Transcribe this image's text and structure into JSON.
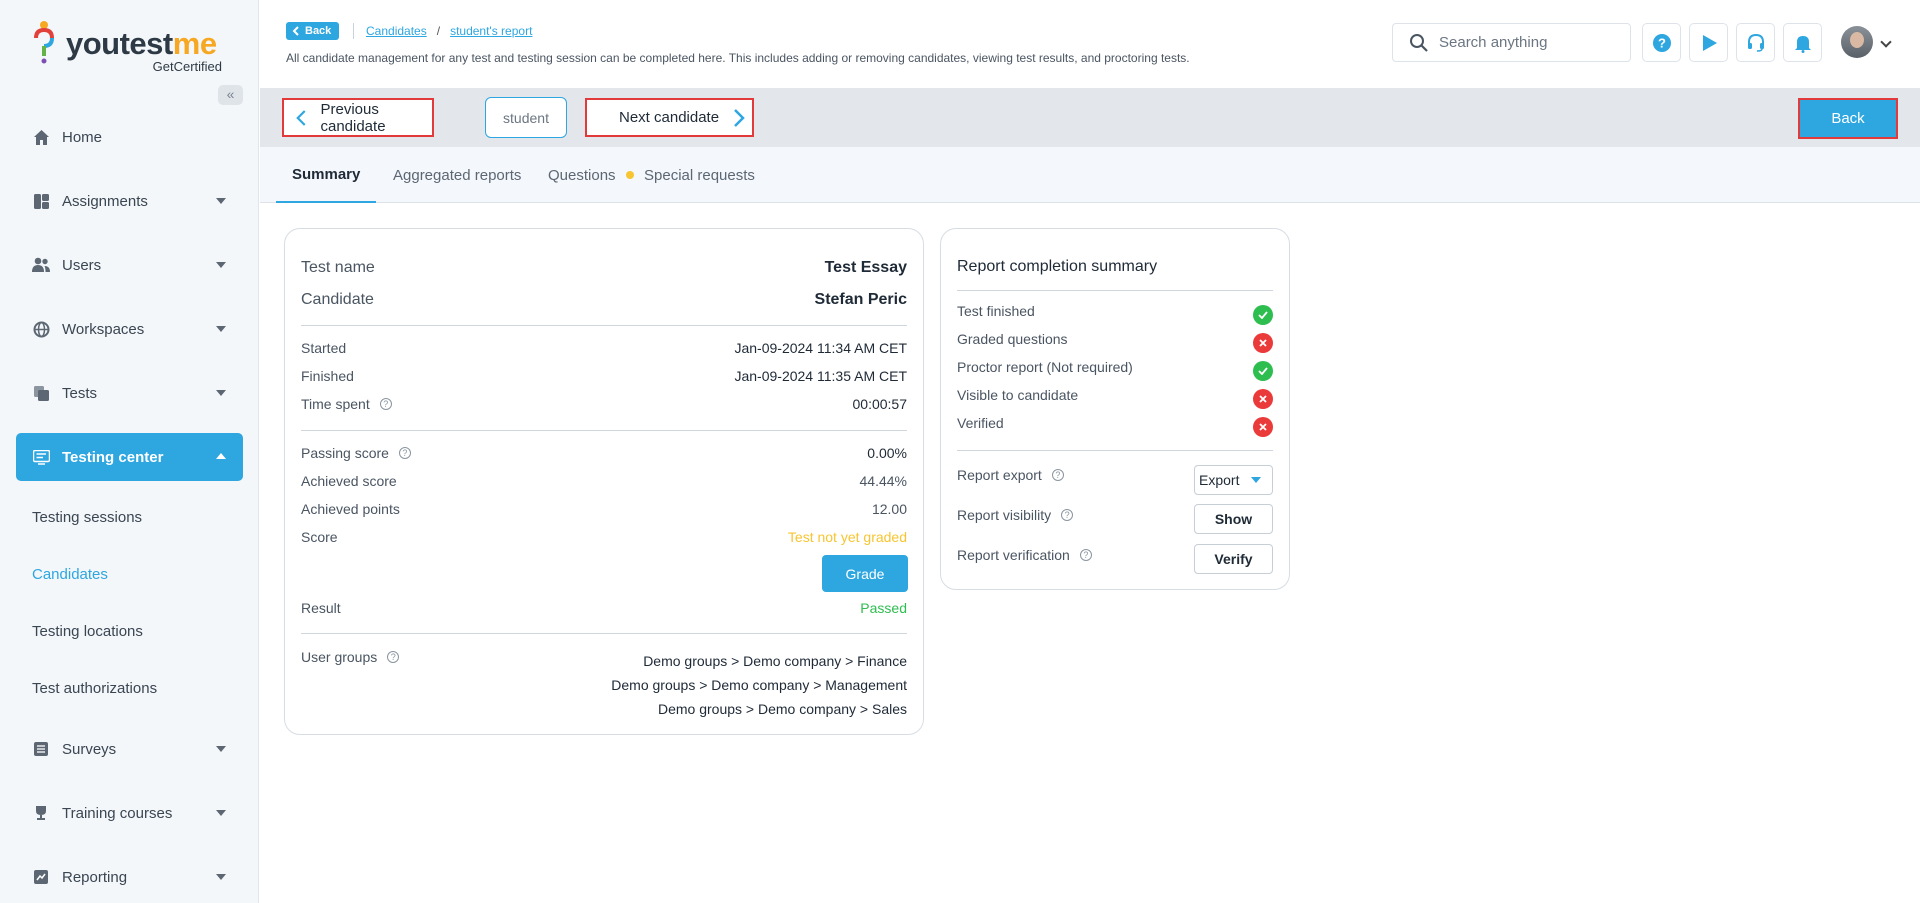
{
  "brand": {
    "name_part1": "youtest",
    "name_part2": "me",
    "sub": "GetCertified"
  },
  "sidebar": {
    "collapse_glyph": "«",
    "items": [
      {
        "label": "Home",
        "icon": "home-icon"
      },
      {
        "label": "Assignments",
        "icon": "assignments-icon"
      },
      {
        "label": "Users",
        "icon": "users-icon"
      },
      {
        "label": "Workspaces",
        "icon": "globe-icon"
      },
      {
        "label": "Tests",
        "icon": "tests-icon"
      },
      {
        "label": "Testing center",
        "icon": "testing-center-icon"
      }
    ],
    "sub_items": [
      "Testing sessions",
      "Candidates",
      "Testing locations",
      "Test authorizations"
    ],
    "items_after": [
      {
        "label": "Surveys",
        "icon": "surveys-icon"
      },
      {
        "label": "Training courses",
        "icon": "trophy-icon"
      },
      {
        "label": "Reporting",
        "icon": "reporting-icon"
      }
    ]
  },
  "header": {
    "back_label": "Back",
    "breadcrumb": [
      "Candidates",
      "student's report"
    ],
    "separator": "/",
    "description": "All candidate management for any test and testing session can be completed here. This includes adding or removing candidates, viewing test results, and proctoring tests.",
    "search_placeholder": "Search anything"
  },
  "candidate_nav": {
    "prev_label": "Previous candidate",
    "current": "student",
    "next_label": "Next candidate",
    "back_label": "Back"
  },
  "tabs": [
    "Summary",
    "Aggregated reports",
    "Questions",
    "Special requests"
  ],
  "summary": {
    "test_name_label": "Test name",
    "test_name": "Test Essay",
    "candidate_label": "Candidate",
    "candidate": "Stefan Peric",
    "started_label": "Started",
    "started": "Jan-09-2024 11:34 AM CET",
    "finished_label": "Finished",
    "finished": "Jan-09-2024 11:35 AM CET",
    "time_spent_label": "Time spent",
    "time_spent": "00:00:57",
    "passing_score_label": "Passing score",
    "passing_score": "0.00%",
    "achieved_score_label": "Achieved score",
    "achieved_score": "44.44%",
    "achieved_points_label": "Achieved points",
    "achieved_points": "12.00",
    "score_label": "Score",
    "score": "Test not yet graded",
    "grade_button": "Grade",
    "result_label": "Result",
    "result": "Passed",
    "user_groups_label": "User groups",
    "user_groups": [
      "Demo groups > Demo company > Finance",
      "Demo groups > Demo company > Management",
      "Demo groups > Demo company > Sales"
    ]
  },
  "report": {
    "title": "Report completion summary",
    "checks": [
      {
        "label": "Test finished",
        "status": "ok"
      },
      {
        "label": "Graded questions",
        "status": "bad"
      },
      {
        "label": "Proctor report (Not required)",
        "status": "ok"
      },
      {
        "label": "Visible to candidate",
        "status": "bad"
      },
      {
        "label": "Verified",
        "status": "bad"
      }
    ],
    "export_label": "Report export",
    "export_button": "Export",
    "visibility_label": "Report visibility",
    "visibility_button": "Show",
    "verification_label": "Report verification",
    "verification_button": "Verify"
  },
  "colors": {
    "accent": "#2ea6e0",
    "warning": "#f7c531",
    "success": "#2ebd4f",
    "danger": "#ea3a3a",
    "highlight_border": "#e23a3a"
  }
}
